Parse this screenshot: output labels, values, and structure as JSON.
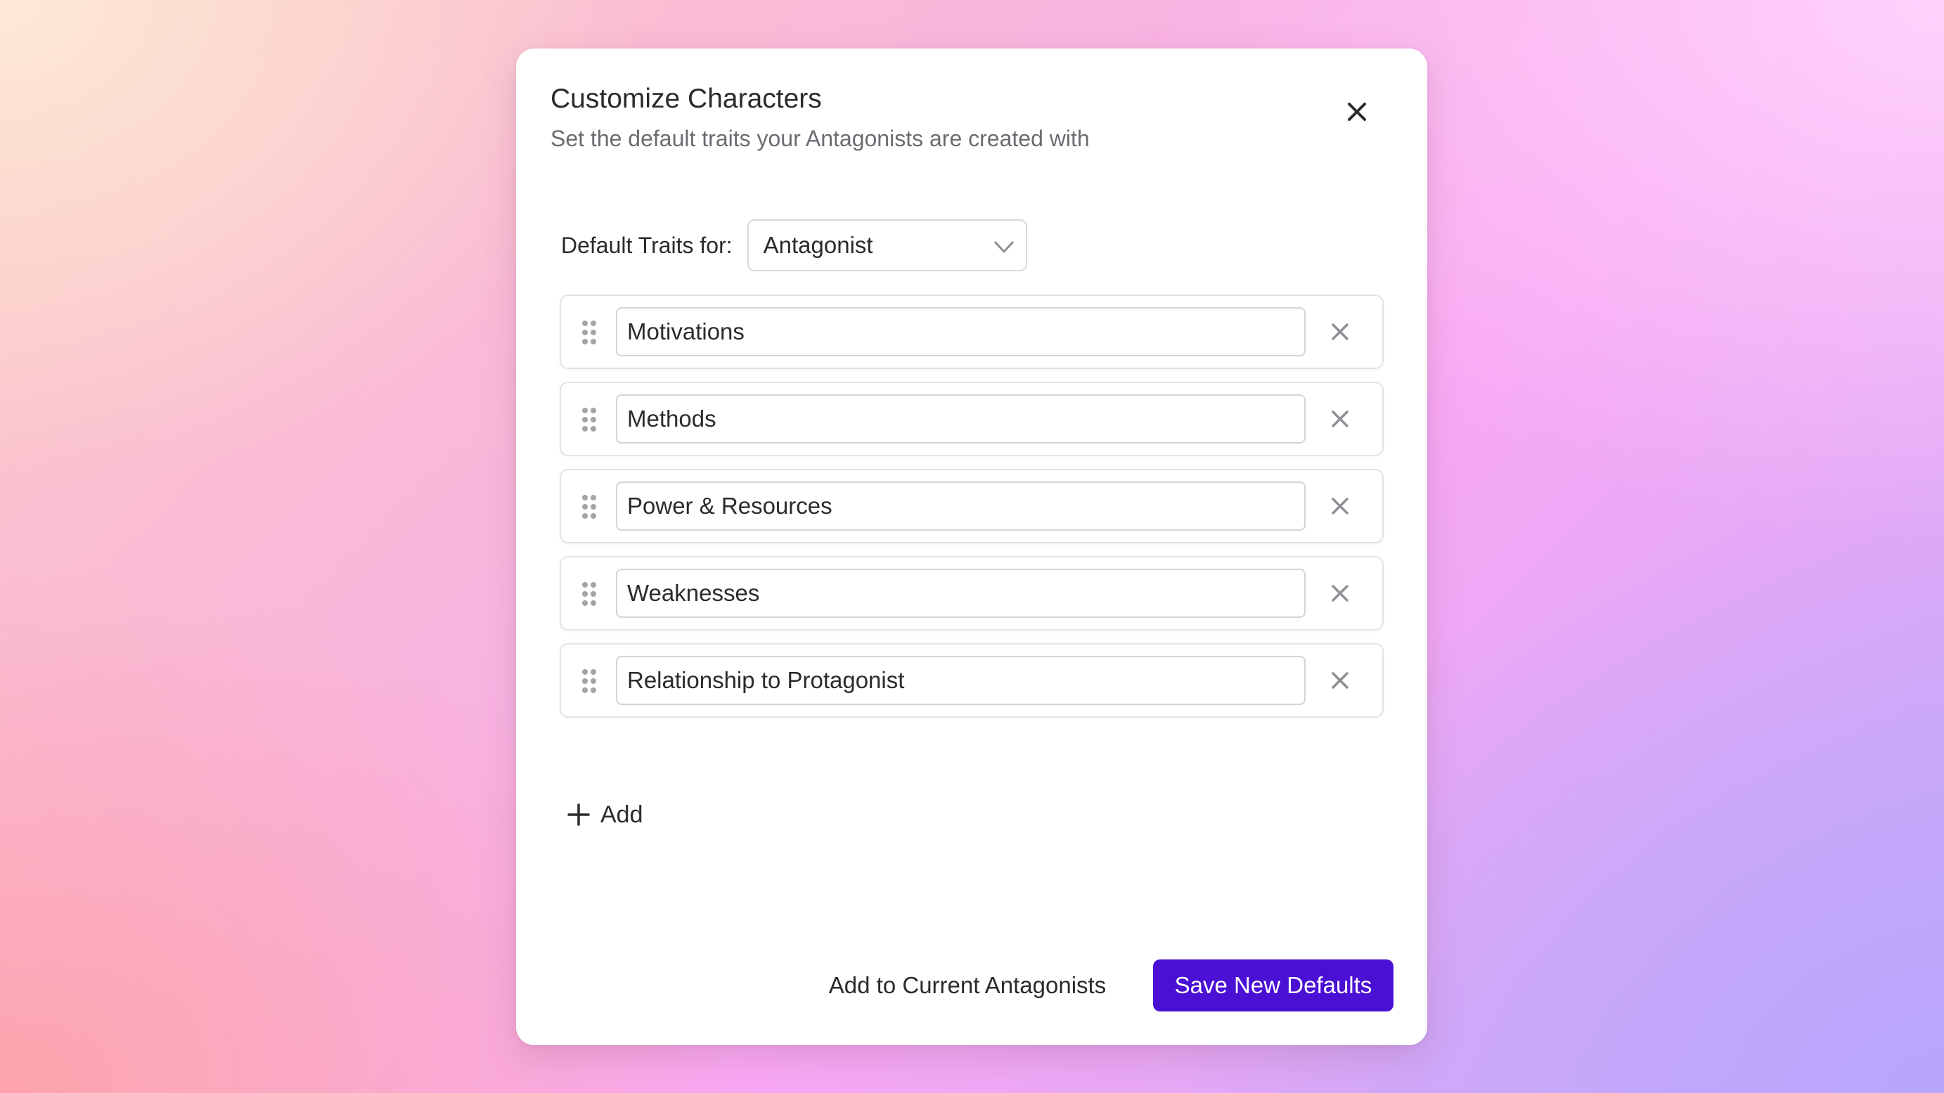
{
  "dialog": {
    "title": "Customize Characters",
    "subtitle": "Set the default traits your Antagonists are created with",
    "close_icon": "close-icon"
  },
  "selector": {
    "label": "Default Traits for:",
    "selected": "Antagonist",
    "chevron_icon": "chevron-down-icon"
  },
  "traits": [
    {
      "value": "Motivations"
    },
    {
      "value": "Methods"
    },
    {
      "value": "Power & Resources"
    },
    {
      "value": "Weaknesses"
    },
    {
      "value": "Relationship to Protagonist"
    }
  ],
  "add_button": {
    "label": "Add",
    "icon": "plus-icon"
  },
  "footer": {
    "secondary_label": "Add to Current Antagonists",
    "primary_label": "Save New Defaults"
  },
  "colors": {
    "primary": "#4a10d4",
    "text": "#2b2b2f",
    "muted_icon": "#8e8e94"
  }
}
